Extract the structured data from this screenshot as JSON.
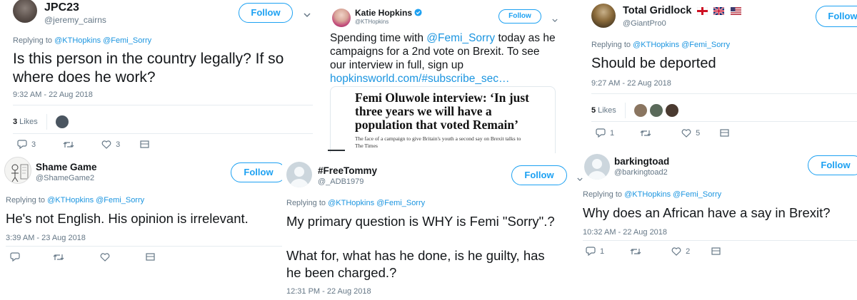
{
  "tweets": {
    "jpc": {
      "name": "JPC23",
      "handle": "@jeremy_cairns",
      "follow": "Follow",
      "replying_prefix": "Replying to",
      "replying_mentions": "@KTHopkins @Femi_Sorry",
      "text_line1": "Is this person in the country legally? If so",
      "text_line2": "where does he work?",
      "time": "9:32 AM - 22 Aug 2018",
      "likes_count": "3",
      "likes_label": "Likes",
      "replies": "3",
      "likes": "3"
    },
    "katie": {
      "name": "Katie Hopkins",
      "handle": "@KTHopkins",
      "follow": "Follow",
      "text_part1": "Spending time with",
      "mention": "@Femi_Sorry",
      "text_part2": "today as he",
      "text_line2": "campaigns for a 2nd vote on Brexit. To see",
      "text_line3": "our interview in full, sign up",
      "link": "hopkinsworld.com/#subscribe_sec…",
      "card_headline_line1": "Femi Oluwole interview: ‘In just",
      "card_headline_line2": "three years we will have a",
      "card_headline_line3": "population that voted Remain’",
      "card_sub_line1": "The face of a campaign to give Britain's youth a second say on Brexit talks to",
      "card_sub_line2": "The Times"
    },
    "gridlock": {
      "name": "Total Gridlock",
      "handle": "@GiantPro0",
      "follow": "Follow",
      "replying_prefix": "Replying to",
      "replying_mentions": "@KTHopkins @Femi_Sorry",
      "text": "Should be deported",
      "time": "9:27 AM - 22 Aug 2018",
      "likes_count": "5",
      "likes_label": "Likes",
      "replies": "1",
      "likes": "5"
    },
    "shame": {
      "name": "Shame Game",
      "handle": "@ShameGame2",
      "follow": "Follow",
      "replying_prefix": "Replying to",
      "replying_mentions": "@KTHopkins @Femi_Sorry",
      "text": "He's not English.  His opinion is irrelevant.",
      "time": "3:39 AM - 23 Aug 2018"
    },
    "tommy": {
      "name": "#FreeTommy",
      "handle": "@_ADB1979",
      "follow": "Follow",
      "replying_prefix": "Replying to",
      "replying_mentions": "@KTHopkins @Femi_Sorry",
      "text_line1": "My primary question is WHY is Femi \"Sorry\".?",
      "text_line2": "What for, what has he done, is he guilty, has",
      "text_line3": "he been charged.?",
      "time": "12:31 PM - 22 Aug 2018"
    },
    "toad": {
      "name": "barkingtoad",
      "handle": "@barkingtoad2",
      "follow": "Follow",
      "replying_prefix": "Replying to",
      "replying_mentions": "@KTHopkins @Femi_Sorry",
      "text": "Why does an African have a say in Brexit?",
      "time": "10:32 AM - 22 Aug 2018",
      "replies": "1",
      "likes": "2"
    }
  },
  "colors": {
    "accent": "#1da1f2",
    "mention": "#1b95e0",
    "muted": "#657786",
    "text": "#14171a"
  }
}
